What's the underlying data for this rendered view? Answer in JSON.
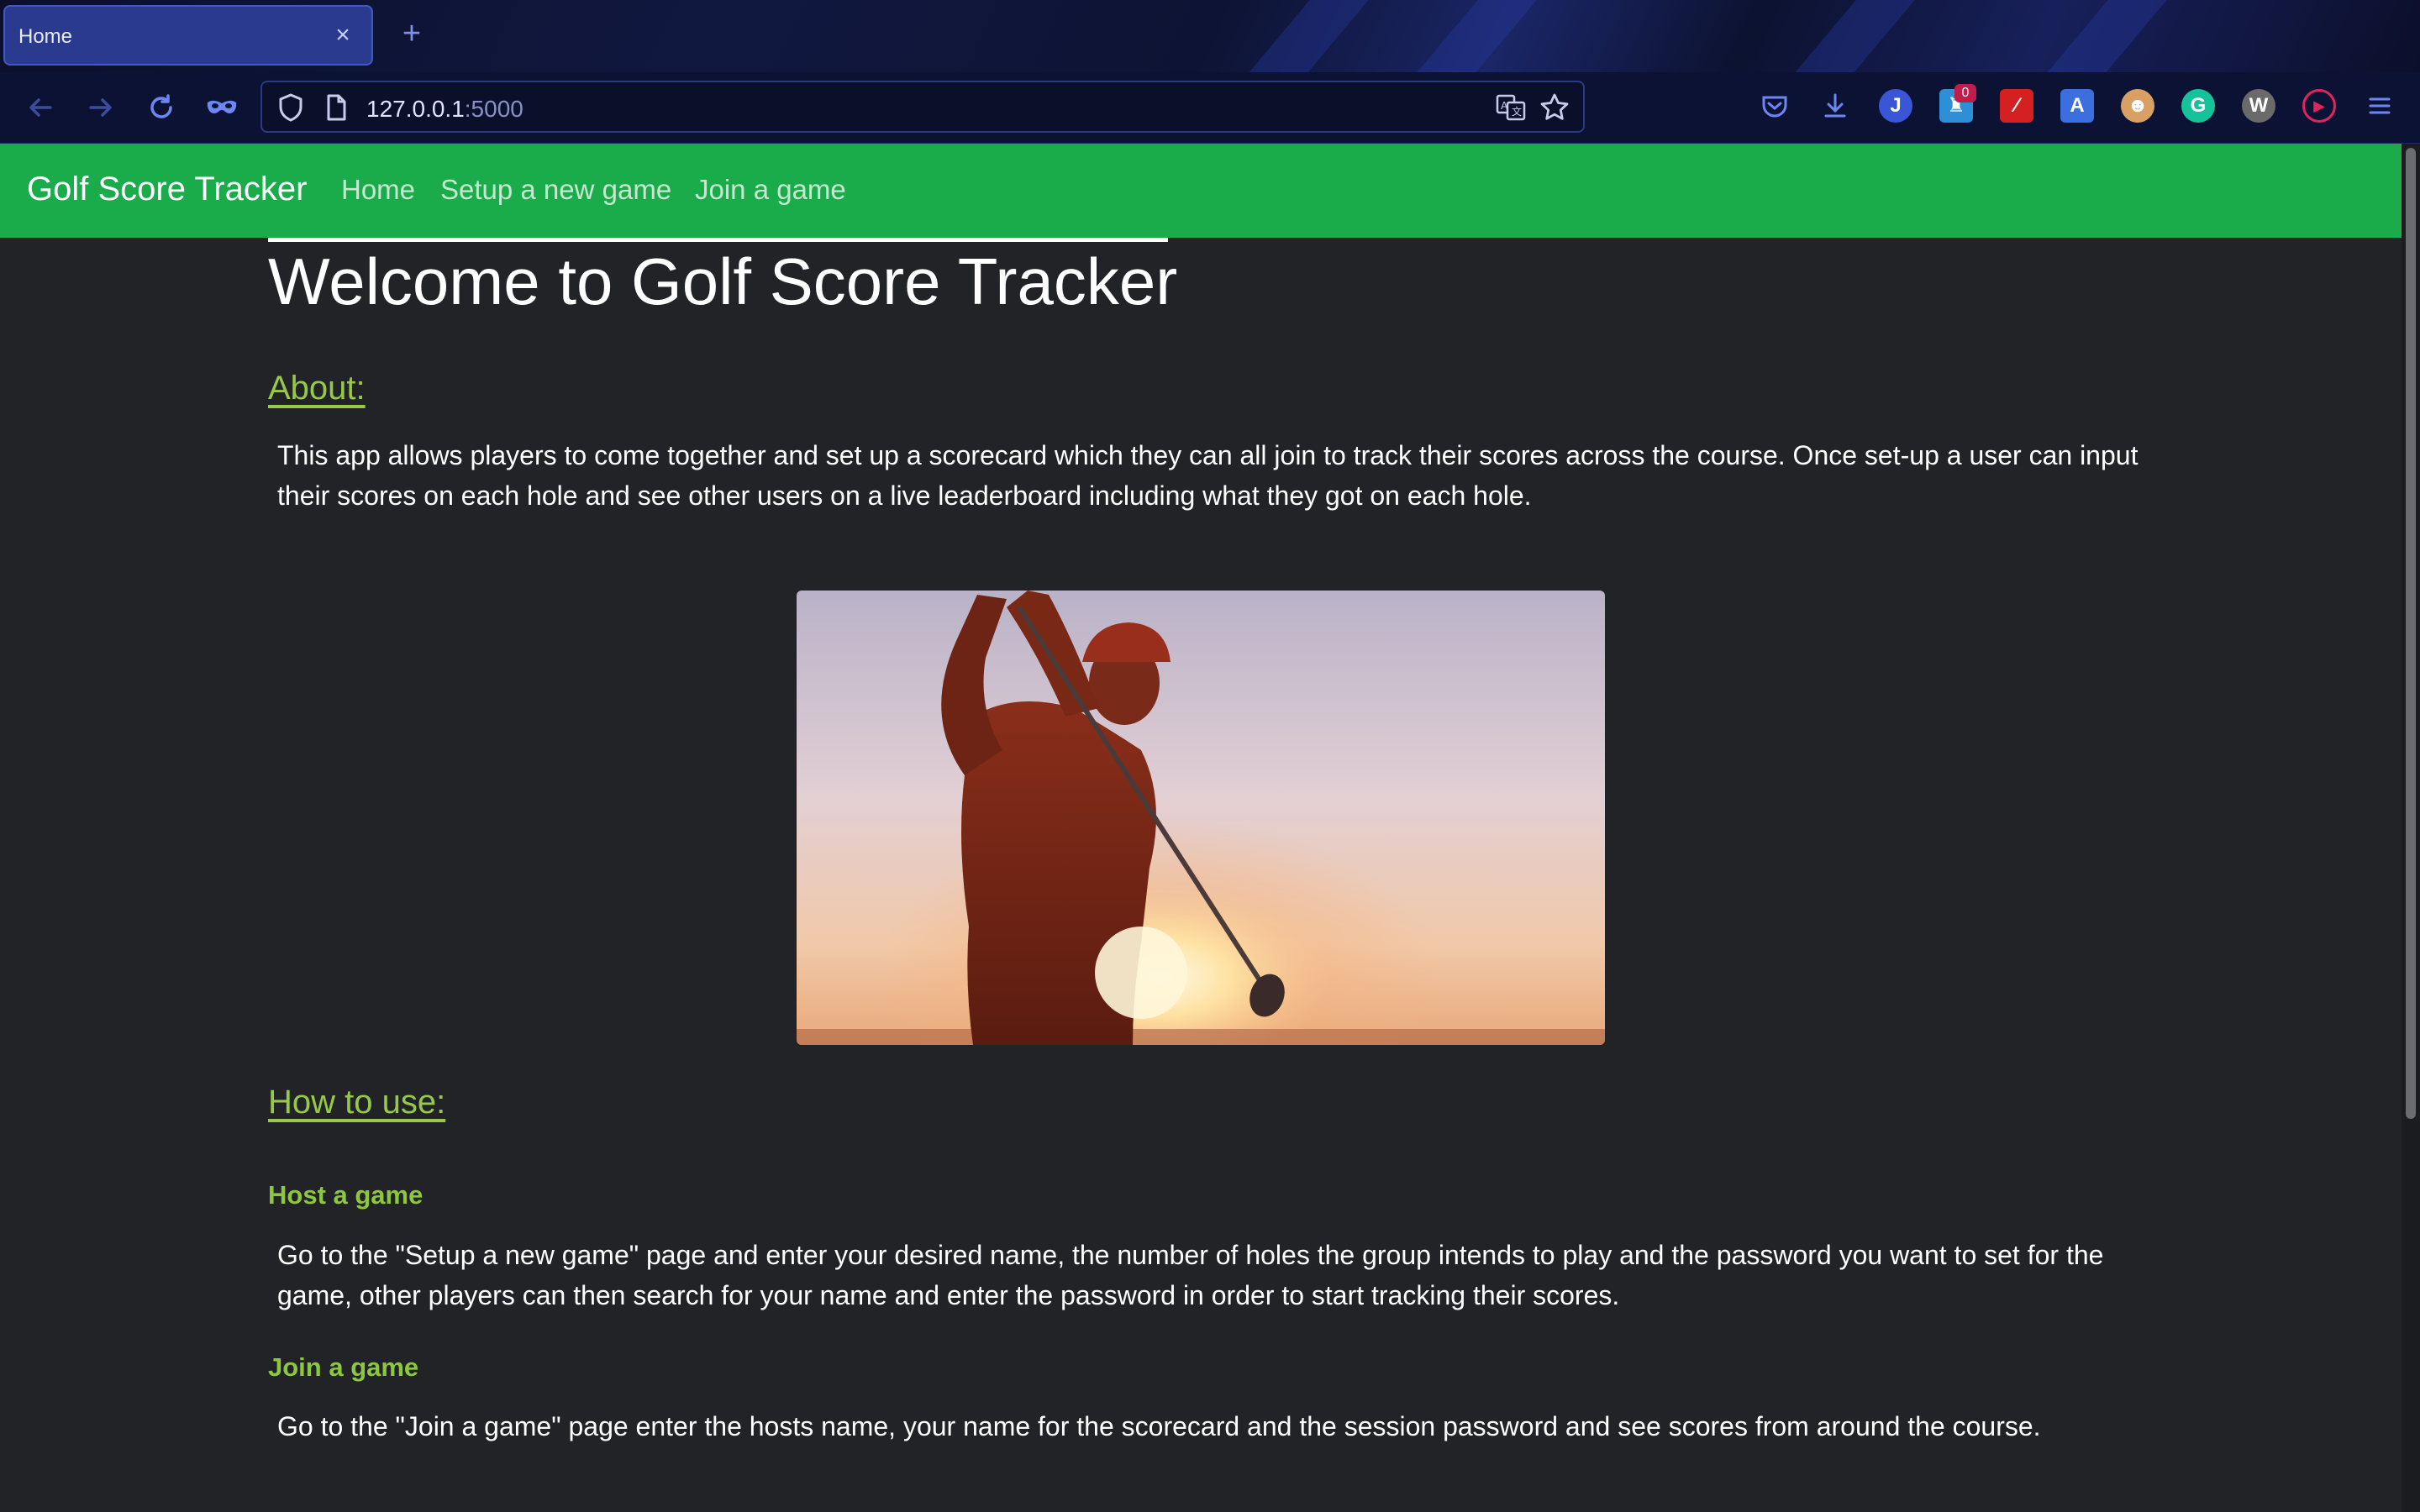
{
  "browser": {
    "tab_title": "Home",
    "tab_close": "×",
    "new_tab": "+",
    "url_host": "127.0.0.1",
    "url_port": ":5000",
    "extension_badge": "0"
  },
  "site": {
    "brand": "Golf Score Tracker",
    "nav": [
      "Home",
      "Setup a new game",
      "Join a game"
    ]
  },
  "page": {
    "title": "Welcome to Golf Score Tracker",
    "about_heading": "About:",
    "about_text": "This app allows players to come together and set up a scorecard which they can all join to track their scores across the course. Once set-up a user can input their scores on each hole and see other users on a live leaderboard including what they got on each hole.",
    "how_heading": "How to use:",
    "host_heading": "Host a game",
    "host_text": "Go to the \"Setup a new game\" page and enter your desired name, the number of holes the group intends to play and the password you want to set for the game, other players can then search for your name and enter the password in order to start tracking their scores.",
    "join_heading": "Join a game",
    "join_text": "Go to the \"Join a game\" page enter the hosts name, your name for the scorecard and the session password and see scores from around the course."
  },
  "colors": {
    "navbar": "#1aab4b",
    "heading_green": "#97c84a",
    "background": "#212326"
  },
  "icons": {
    "back": "back-arrow-icon",
    "forward": "forward-arrow-icon",
    "reload": "reload-icon",
    "private": "private-browsing-mask-icon",
    "shield": "tracking-protection-shield-icon",
    "page": "page-icon",
    "translate": "translate-icon",
    "bookmark": "bookmark-star-icon",
    "menu": "hamburger-menu-icon"
  }
}
